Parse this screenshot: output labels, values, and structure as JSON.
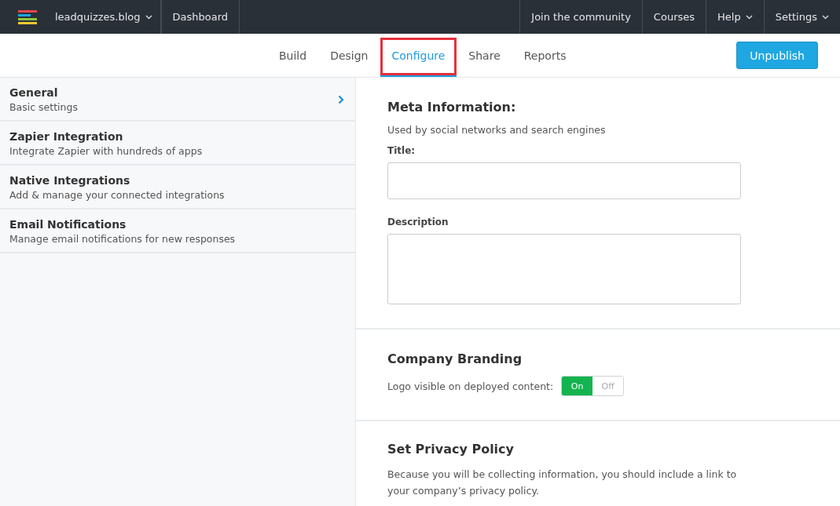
{
  "topbar": {
    "site": "leadquizzes.blog",
    "left_links": [
      {
        "label": "Dashboard"
      }
    ],
    "right_links": [
      {
        "label": "Join the community",
        "dropdown": false
      },
      {
        "label": "Courses",
        "dropdown": false
      },
      {
        "label": "Help",
        "dropdown": true
      },
      {
        "label": "Settings",
        "dropdown": true
      }
    ]
  },
  "tabs": [
    {
      "label": "Build",
      "selected": false,
      "highlighted": false
    },
    {
      "label": "Design",
      "selected": false,
      "highlighted": false
    },
    {
      "label": "Configure",
      "selected": true,
      "highlighted": true
    },
    {
      "label": "Share",
      "selected": false,
      "highlighted": false
    },
    {
      "label": "Reports",
      "selected": false,
      "highlighted": false
    }
  ],
  "publish_button": "Unpublish",
  "sidebar": {
    "items": [
      {
        "title": "General",
        "subtitle": "Basic settings",
        "selected": true
      },
      {
        "title": "Zapier Integration",
        "subtitle": "Integrate Zapier with hundreds of apps",
        "selected": false
      },
      {
        "title": "Native Integrations",
        "subtitle": "Add & manage your connected integrations",
        "selected": false
      },
      {
        "title": "Email Notifications",
        "subtitle": "Manage email notifications for new responses",
        "selected": false
      }
    ]
  },
  "meta": {
    "heading": "Meta Information:",
    "note": "Used by social networks and search engines",
    "fields": [
      {
        "label": "Title:",
        "kind": "input"
      },
      {
        "label": "Description",
        "kind": "textarea"
      }
    ]
  },
  "branding": {
    "heading": "Company Branding",
    "label": "Logo visible on deployed content:",
    "options": [
      {
        "label": "On",
        "selected": true
      },
      {
        "label": "Off",
        "selected": false
      }
    ]
  },
  "privacy": {
    "heading": "Set Privacy Policy",
    "text": "Because you will be collecting information, you should include a link to your company’s privacy policy."
  }
}
